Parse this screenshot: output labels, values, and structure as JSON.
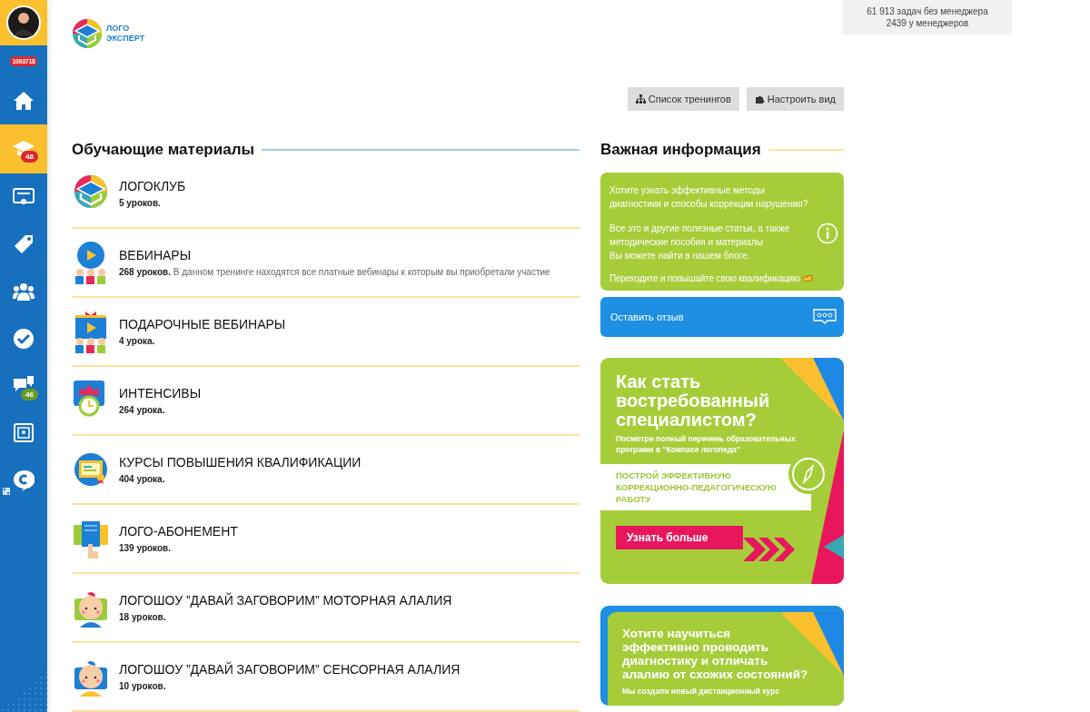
{
  "sidebar": {
    "user_badge": {
      "text": "1093718",
      "color": "#e0282e"
    },
    "items": [
      {
        "selected": false
      },
      {
        "selected": true,
        "badge": {
          "text": "48",
          "color": "#d9272e"
        }
      },
      {
        "selected": false
      },
      {
        "selected": false
      },
      {
        "selected": false
      },
      {
        "selected": false
      },
      {
        "selected": false,
        "badge": {
          "text": "46",
          "color": "#6a9a2c"
        }
      },
      {
        "selected": false
      },
      {
        "selected": false
      }
    ]
  },
  "header": {
    "logo": {
      "line_1": "ЛОГО",
      "line_2": "ЭКСПЕРТ"
    },
    "stats": [
      "61 913 задач без менеджера",
      "2439 у менеджеров"
    ]
  },
  "toolbar": {
    "buttons": [
      {
        "label": "Список тренингов"
      },
      {
        "label": "Настроить вид"
      }
    ]
  },
  "materials": {
    "title": "Обучающие материалы",
    "items": [
      {
        "title": "ЛОГОКЛУБ",
        "count": "5 уроков."
      },
      {
        "title": "ВЕБИНАРЫ",
        "count": "268 уроков.",
        "description": "В данном тренинге находятся все платные вебинары к которым вы приобретали участие"
      },
      {
        "title": "ПОДАРОЧНЫЕ ВЕБИНАРЫ",
        "count": "4 урока."
      },
      {
        "title": "ИНТЕНСИВЫ",
        "count": "264 урока."
      },
      {
        "title": "КУРСЫ ПОВЫШЕНИЯ КВАЛИФИКАЦИИ",
        "count": "404 урока."
      },
      {
        "title": "ЛОГО-АБОНЕМЕНТ",
        "count": "139 уроков."
      },
      {
        "title": "ЛОГОШОУ ”ДАВАЙ ЗАГОВОРИМ” МОТОРНАЯ АЛАЛИЯ",
        "count": "18 уроков."
      },
      {
        "title": "ЛОГОШОУ ”ДАВАЙ ЗАГОВОРИМ” СЕНСОРНАЯ АЛАЛИЯ",
        "count": "10 уроков."
      }
    ]
  },
  "info": {
    "title": "Важная информация",
    "card": {
      "paragraphs": [
        "Хотите узнать эффективные методы диагностики и способы коррекции нарушения?",
        "Все это и другие полезные статьи, а также\nметодические пособия и материалы\nВы можете найти в нашем блоге."
      ],
      "link": "Переходите и повышайте свою квалификацию"
    },
    "feedback": "Оставить отзыв",
    "banners": [
      {
        "kind": "promo",
        "heading": "Как стать\nвостребованный\nспециалистом?",
        "subtitle": "Посмотри полный перечень образовательных\nпрограмм в \"Компасе логопеда\"",
        "strip": "ПОСТРОЙ ЭФФЕКТИВНУЮ\nКОРРЕКЦИОННО-ПЕДАГОГИЧЕСКУЮ\nРАБОТУ",
        "button": "Узнать больше"
      },
      {
        "kind": "framed",
        "heading": "Хотите научиться\nэффективно проводить\nдиагностику и отличать\nалалию от схожих состояний?",
        "subtitle": "Мы создали новый дистанционный курс"
      }
    ]
  }
}
